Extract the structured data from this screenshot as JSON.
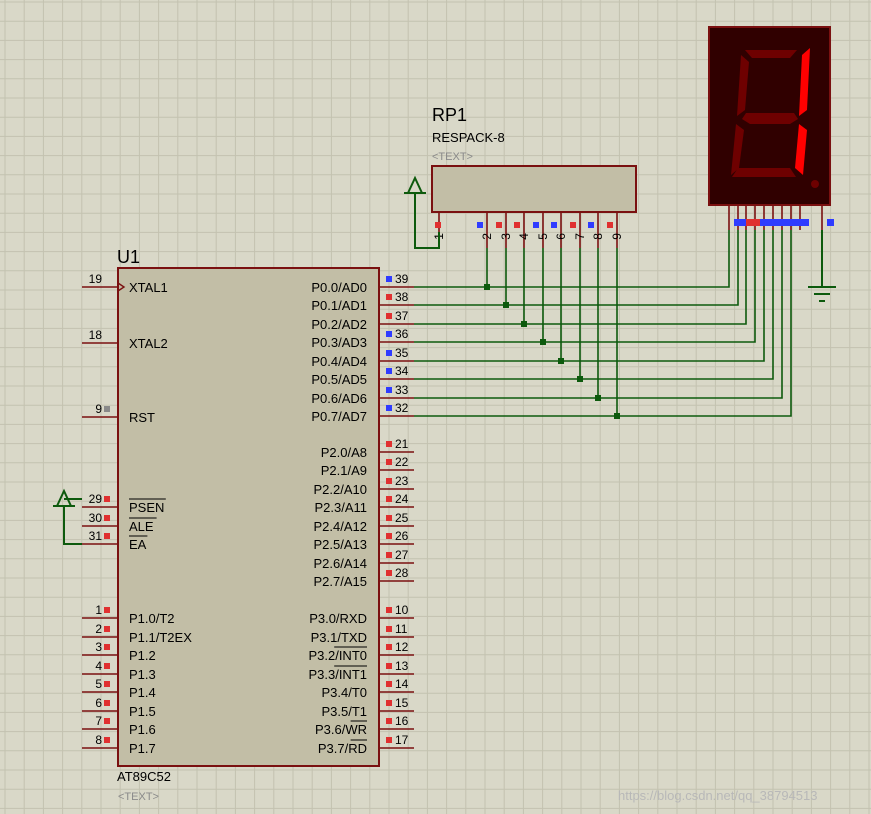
{
  "u1": {
    "ref": "U1",
    "part": "AT89C52",
    "text": "<TEXT>",
    "left_pins": [
      {
        "num": "19",
        "name": "XTAL1"
      },
      {
        "num": "18",
        "name": "XTAL2"
      },
      {
        "num": "9",
        "name": "RST"
      },
      {
        "num": "29",
        "name": "PSEN"
      },
      {
        "num": "30",
        "name": "ALE"
      },
      {
        "num": "31",
        "name": "EA"
      },
      {
        "num": "1",
        "name": "P1.0/T2"
      },
      {
        "num": "2",
        "name": "P1.1/T2EX"
      },
      {
        "num": "3",
        "name": "P1.2"
      },
      {
        "num": "4",
        "name": "P1.3"
      },
      {
        "num": "5",
        "name": "P1.4"
      },
      {
        "num": "6",
        "name": "P1.5"
      },
      {
        "num": "7",
        "name": "P1.6"
      },
      {
        "num": "8",
        "name": "P1.7"
      }
    ],
    "right_pins": [
      {
        "num": "39",
        "name": "P0.0/AD0"
      },
      {
        "num": "38",
        "name": "P0.1/AD1"
      },
      {
        "num": "37",
        "name": "P0.2/AD2"
      },
      {
        "num": "36",
        "name": "P0.3/AD3"
      },
      {
        "num": "35",
        "name": "P0.4/AD4"
      },
      {
        "num": "34",
        "name": "P0.5/AD5"
      },
      {
        "num": "33",
        "name": "P0.6/AD6"
      },
      {
        "num": "32",
        "name": "P0.7/AD7"
      },
      {
        "num": "21",
        "name": "P2.0/A8"
      },
      {
        "num": "22",
        "name": "P2.1/A9"
      },
      {
        "num": "23",
        "name": "P2.2/A10"
      },
      {
        "num": "24",
        "name": "P2.3/A11"
      },
      {
        "num": "25",
        "name": "P2.4/A12"
      },
      {
        "num": "26",
        "name": "P2.5/A13"
      },
      {
        "num": "27",
        "name": "P2.6/A14"
      },
      {
        "num": "28",
        "name": "P2.7/A15"
      },
      {
        "num": "10",
        "name": "P3.0/RXD"
      },
      {
        "num": "11",
        "name": "P3.1/TXD"
      },
      {
        "num": "12",
        "name": "P3.2/INT0"
      },
      {
        "num": "13",
        "name": "P3.3/INT1"
      },
      {
        "num": "14",
        "name": "P3.4/T0"
      },
      {
        "num": "15",
        "name": "P3.5/T1"
      },
      {
        "num": "16",
        "name": "P3.6/WR"
      },
      {
        "num": "17",
        "name": "P3.7/RD"
      }
    ]
  },
  "rp1": {
    "ref": "RP1",
    "part": "RESPACK-8",
    "text": "<TEXT>",
    "pins": [
      "1",
      "2",
      "3",
      "4",
      "5",
      "6",
      "7",
      "8",
      "9"
    ]
  },
  "display": {
    "digit": "1"
  },
  "watermark": "https://blog.csdn.net/qq_38794513",
  "colors": {
    "background": "#d9d8c8",
    "grid": "#c3c2b0",
    "grid_major": "#b3b2a0",
    "body_fill": "#c2bea6",
    "body_stroke": "#7a1010",
    "wire": "#0d5a0d",
    "pin_red": "#e03030",
    "pin_blue": "#2f3cff",
    "pin_grey": "#8a8a8a",
    "seg_on": "#ff0000",
    "seg_off": "#6e0000",
    "display_bg": "#300000"
  }
}
